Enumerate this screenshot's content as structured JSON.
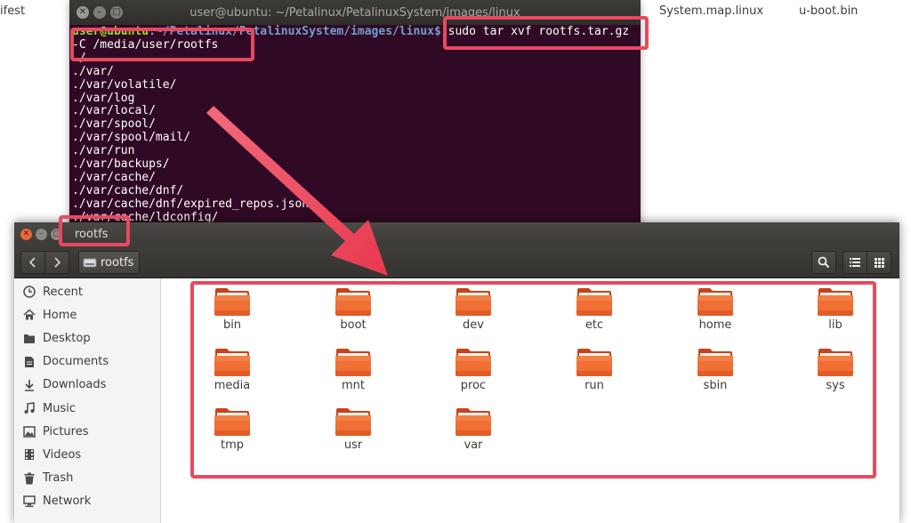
{
  "desktop": {
    "files": [
      "ifest",
      "System.map.linux",
      "u-boot.bin"
    ]
  },
  "terminal": {
    "title": "user@ubuntu: ~/Petalinux/PetalinuxSystem/images/linux",
    "prompt_user": "user@ubuntu",
    "prompt_path": ":~/Petalinux/PetalinuxSystem/images/linux$",
    "command": " sudo tar xvf rootfs.tar.gz",
    "command_cont": "-C /media/user/rootfs",
    "output": [
      "./",
      "./var/",
      "./var/volatile/",
      "./var/log",
      "./var/local/",
      "./var/spool/",
      "./var/spool/mail/",
      "./var/run",
      "./var/backups/",
      "./var/cache/",
      "./var/cache/dnf/",
      "./var/cache/dnf/expired_repos.json",
      "./var/cache/ldconfig/"
    ]
  },
  "files": {
    "title": "rootfs",
    "path_label": "rootfs",
    "sidebar": [
      {
        "label": "Recent",
        "icon": "clock-icon"
      },
      {
        "label": "Home",
        "icon": "home-icon"
      },
      {
        "label": "Desktop",
        "icon": "desktop-folder-icon"
      },
      {
        "label": "Documents",
        "icon": "documents-icon"
      },
      {
        "label": "Downloads",
        "icon": "download-icon"
      },
      {
        "label": "Music",
        "icon": "music-icon"
      },
      {
        "label": "Pictures",
        "icon": "pictures-icon"
      },
      {
        "label": "Videos",
        "icon": "videos-icon"
      },
      {
        "label": "Trash",
        "icon": "trash-icon"
      },
      {
        "label": "Network",
        "icon": "network-icon"
      }
    ],
    "folders": [
      "bin",
      "boot",
      "dev",
      "etc",
      "home",
      "lib",
      "media",
      "mnt",
      "proc",
      "run",
      "sbin",
      "sys",
      "tmp",
      "usr",
      "var"
    ]
  },
  "colors": {
    "highlight": "#e8495f",
    "terminal_bg": "#300a24",
    "folder": "#e95420"
  }
}
